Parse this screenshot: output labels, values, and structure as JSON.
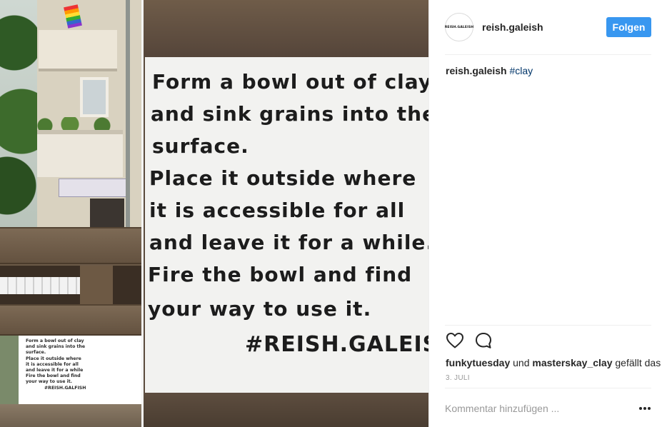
{
  "photo": {
    "left_sign_lines": [
      "Form a bowl out of clay",
      "and sink grains into the",
      "surface.",
      "Place it outside where",
      "it is accessible for all",
      "and leave it for a while",
      "Fire the bowl and find",
      "your way to use it.",
      "#REISH.GALFISH"
    ],
    "right_sign_lines": [
      "Form a bowl out of clay",
      "and sink grains into the",
      "surface.",
      "Place it outside where",
      "it is accessible for all",
      "and leave it for a while.",
      "Fire the bowl and find",
      "your way to use it."
    ],
    "right_sign_tag": "#REISH.GALEISH"
  },
  "header": {
    "avatar_text": "REISH.GALEISH",
    "username": "reish.galeish",
    "follow_label": "Folgen"
  },
  "caption": {
    "username": "reish.galeish",
    "hashtag": "#clay"
  },
  "actions": {
    "like_icon": "heart-outline-icon",
    "comment_icon": "speech-bubble-icon"
  },
  "likes": {
    "user1": "funkytuesday",
    "conjunction": "und",
    "user2": "masterskay_clay",
    "suffix": "gefällt das"
  },
  "date": "3. JULI",
  "comment": {
    "placeholder": "Kommentar hinzufügen ...",
    "more_icon": "more-options-icon"
  },
  "colors": {
    "accent": "#3897f0",
    "hashtag": "#003569",
    "muted": "#999999",
    "text": "#262626"
  }
}
